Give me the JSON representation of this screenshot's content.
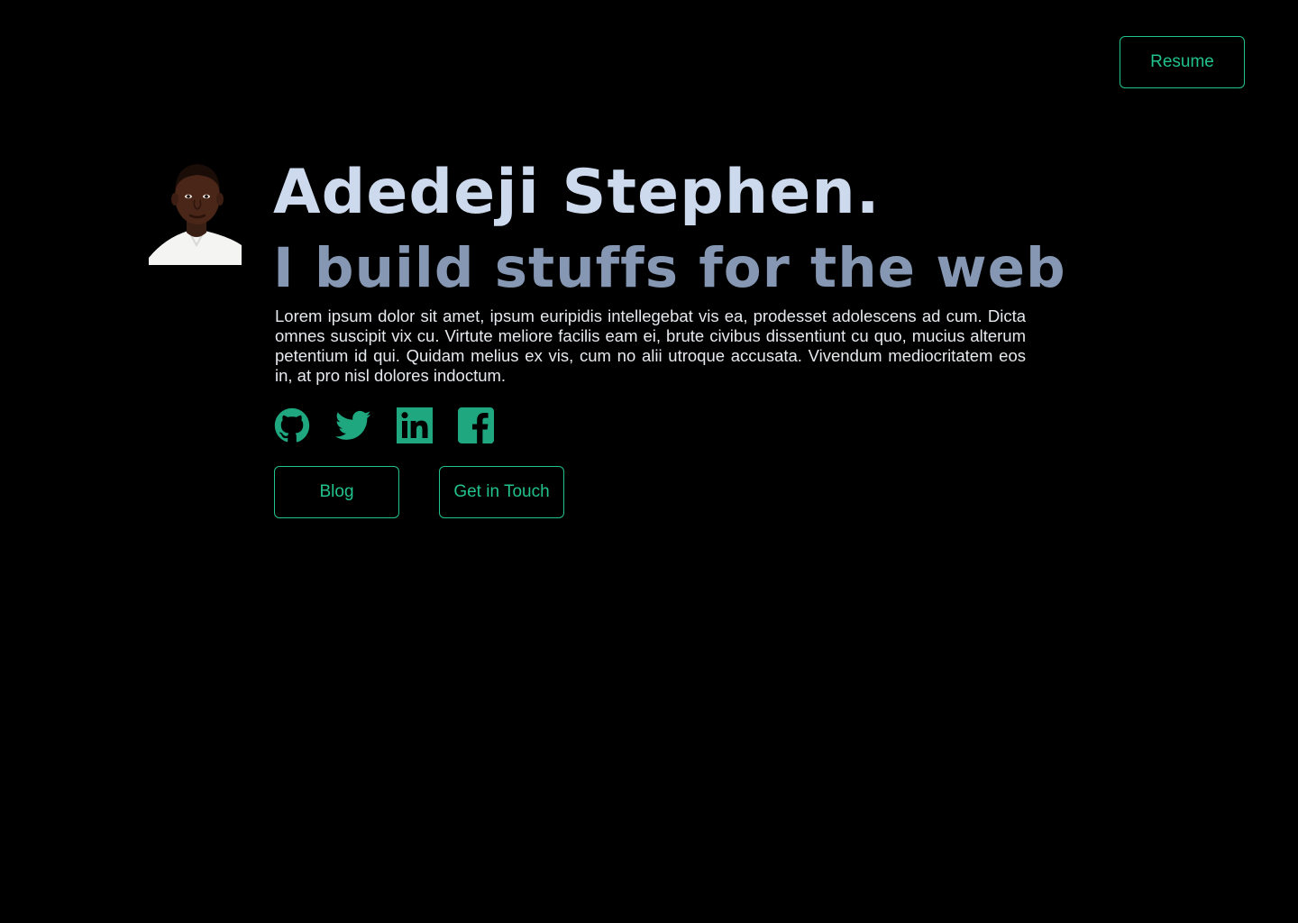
{
  "header": {
    "resume_label": "Resume"
  },
  "hero": {
    "name": "Adedeji Stephen.",
    "tagline": "I build stuffs for the web",
    "bio": "Lorem ipsum dolor sit amet, ipsum euripidis intellegebat vis ea, prodesset adolescens ad cum. Dicta omnes suscipit vix cu. Virtute meliore facilis eam ei, brute civibus dissentiunt cu quo, mucius alterum petentium id qui. Quidam melius ex vis, cum no alii utroque accusata. Vivendum mediocritatem eos in, at pro nisl dolores indoctum."
  },
  "socials": [
    {
      "icon": "github-icon"
    },
    {
      "icon": "twitter-icon"
    },
    {
      "icon": "linkedin-icon"
    },
    {
      "icon": "facebook-icon"
    }
  ],
  "actions": {
    "blog_label": "Blog",
    "contact_label": "Get in Touch"
  },
  "colors": {
    "background": "#000000",
    "accent": "#22c28b",
    "name": "#cdd9ec",
    "tagline": "#8597b2",
    "body_text": "#e6e9ee"
  }
}
